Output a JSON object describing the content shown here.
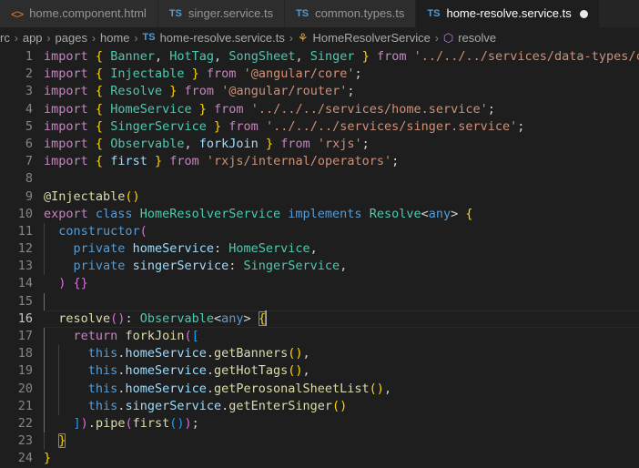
{
  "window": {
    "app": "Visual Studio Code",
    "theme_colors": {
      "editor_background": "#1e1e1e",
      "tabbar_background": "#252526",
      "inactive_tab_background": "#2d2d2d",
      "active_tab_background": "#1e1e1e",
      "line_number": "#858585",
      "accent_keyword": "#c586c0",
      "accent_type": "#4ec9b0",
      "accent_string": "#ce9178",
      "accent_variable": "#9cdcfe",
      "accent_function": "#dcdcaa",
      "accent_blue": "#569cd6"
    }
  },
  "tabs": [
    {
      "label": "home.component.html",
      "icon": "html-file-icon",
      "icon_text": "<>",
      "active": false,
      "dirty": false
    },
    {
      "label": "singer.service.ts",
      "icon": "typescript-file-icon",
      "icon_text": "TS",
      "active": false,
      "dirty": false
    },
    {
      "label": "common.types.ts",
      "icon": "typescript-file-icon",
      "icon_text": "TS",
      "active": false,
      "dirty": false
    },
    {
      "label": "home-resolve.service.ts",
      "icon": "typescript-file-icon",
      "icon_text": "TS",
      "active": true,
      "dirty": true
    }
  ],
  "breadcrumbs": [
    {
      "label": "rc",
      "icon": null,
      "icon_text": ""
    },
    {
      "label": "app",
      "icon": null,
      "icon_text": ""
    },
    {
      "label": "pages",
      "icon": null,
      "icon_text": ""
    },
    {
      "label": "home",
      "icon": null,
      "icon_text": ""
    },
    {
      "label": "home-resolve.service.ts",
      "icon": "typescript-file-icon",
      "icon_text": "TS"
    },
    {
      "label": "HomeResolverService",
      "icon": "class-symbol-icon",
      "icon_text": "⚘"
    },
    {
      "label": "resolve",
      "icon": "method-symbol-icon",
      "icon_text": "⬡"
    }
  ],
  "breadcrumb_separator": "›",
  "editor": {
    "file": "home-resolve.service.ts",
    "language": "TypeScript",
    "current_line": 16,
    "cursor": {
      "line": 16,
      "column": 30
    },
    "total_lines": 24,
    "lines": [
      {
        "n": 1,
        "text": "import { Banner, HotTag, SongSheet, Singer } from '../../../services/data-types/common"
      },
      {
        "n": 2,
        "text": "import { Injectable } from '@angular/core';"
      },
      {
        "n": 3,
        "text": "import { Resolve } from '@angular/router';"
      },
      {
        "n": 4,
        "text": "import { HomeService } from '../../../services/home.service';"
      },
      {
        "n": 5,
        "text": "import { SingerService } from '../../../services/singer.service';"
      },
      {
        "n": 6,
        "text": "import { Observable, forkJoin } from 'rxjs';"
      },
      {
        "n": 7,
        "text": "import { first } from 'rxjs/internal/operators';"
      },
      {
        "n": 8,
        "text": ""
      },
      {
        "n": 9,
        "text": "@Injectable()"
      },
      {
        "n": 10,
        "text": "export class HomeResolverService implements Resolve<any> {"
      },
      {
        "n": 11,
        "text": "  constructor("
      },
      {
        "n": 12,
        "text": "    private homeService: HomeService,"
      },
      {
        "n": 13,
        "text": "    private singerService: SingerService,"
      },
      {
        "n": 14,
        "text": "  ) {}"
      },
      {
        "n": 15,
        "text": ""
      },
      {
        "n": 16,
        "text": "  resolve(): Observable<any> {"
      },
      {
        "n": 17,
        "text": "    return forkJoin(["
      },
      {
        "n": 18,
        "text": "      this.homeService.getBanners(),"
      },
      {
        "n": 19,
        "text": "      this.homeService.getHotTags(),"
      },
      {
        "n": 20,
        "text": "      this.homeService.getPerosonalSheetList(),"
      },
      {
        "n": 21,
        "text": "      this.singerService.getEnterSinger()"
      },
      {
        "n": 22,
        "text": "    ]).pipe(first());"
      },
      {
        "n": 23,
        "text": "  }"
      },
      {
        "n": 24,
        "text": "}"
      }
    ]
  }
}
